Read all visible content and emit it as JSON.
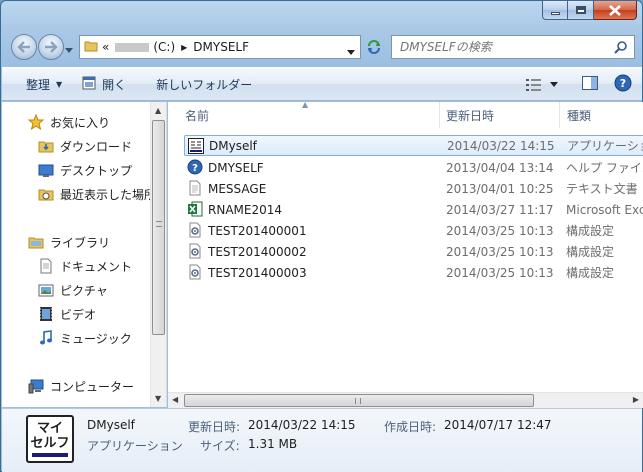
{
  "address": {
    "overflow": "«",
    "drive": "(C:)",
    "folder": "DMYSELF"
  },
  "search": {
    "placeholder": "DMYSELFの検索"
  },
  "toolbar": {
    "organize": "整理",
    "open": "開く",
    "new_folder": "新しいフォルダー"
  },
  "nav": {
    "favorites": "お気に入り",
    "downloads": "ダウンロード",
    "desktop": "デスクトップ",
    "recent": "最近表示した場所",
    "libraries": "ライブラリ",
    "documents": "ドキュメント",
    "pictures": "ピクチャ",
    "videos": "ビデオ",
    "music": "ミュージック",
    "computer": "コンピューター"
  },
  "columns": {
    "name": "名前",
    "date": "更新日時",
    "type": "種類"
  },
  "files": [
    {
      "name": "DMyself",
      "date": "2014/03/22 14:15",
      "type": "アプリケーション",
      "icon": "app-icon"
    },
    {
      "name": "DMYSELF",
      "date": "2013/04/04 13:14",
      "type": "ヘルプ ファイル",
      "icon": "help-icon"
    },
    {
      "name": "MESSAGE",
      "date": "2013/04/01 10:25",
      "type": "テキスト文書",
      "icon": "text-file-icon"
    },
    {
      "name": "RNAME2014",
      "date": "2014/03/27 11:17",
      "type": "Microsoft Excel",
      "icon": "excel-icon"
    },
    {
      "name": "TEST201400001",
      "date": "2014/03/25 10:13",
      "type": "構成設定",
      "icon": "config-icon"
    },
    {
      "name": "TEST201400002",
      "date": "2014/03/25 10:13",
      "type": "構成設定",
      "icon": "config-icon"
    },
    {
      "name": "TEST201400003",
      "date": "2014/03/25 10:13",
      "type": "構成設定",
      "icon": "config-icon"
    }
  ],
  "details": {
    "icon_text_line1": "マイ",
    "icon_text_line2": "セルフ",
    "name": "DMyself",
    "type": "アプリケーション",
    "modified_label": "更新日時:",
    "modified": "2014/03/22 14:15",
    "created_label": "作成日時:",
    "created": "2014/07/17 12:47",
    "size_label": "サイズ:",
    "size": "1.31 MB"
  }
}
